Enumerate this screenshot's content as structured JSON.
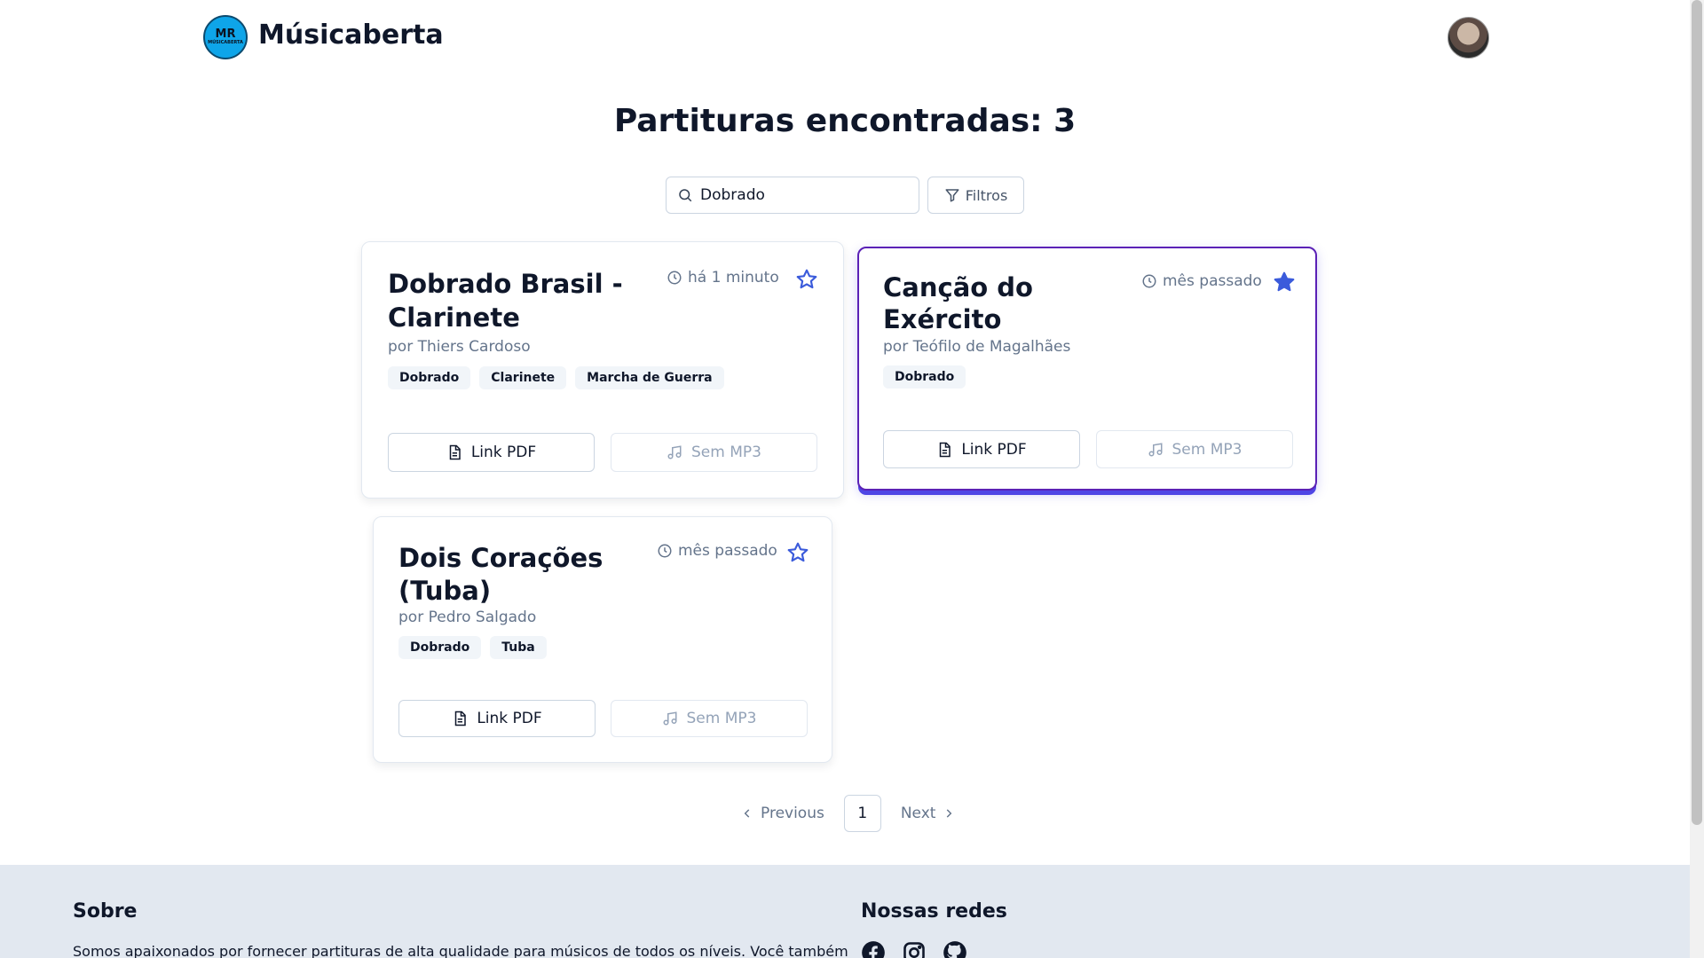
{
  "header": {
    "logo_text": "MR",
    "logo_subtext": "MÚSICABERTA",
    "brand": "Músicaberta"
  },
  "main": {
    "title": "Partituras encontradas: 3",
    "search": {
      "value": "Dobrado",
      "placeholder": ""
    },
    "filter_label": "Filtros"
  },
  "cards": [
    {
      "title_line1": "Dobrado Brasil -",
      "title_line2": "Clarinete",
      "author": "por Thiers Cardoso",
      "time": "há 1 minuto",
      "favorited": false,
      "tags": [
        "Dobrado",
        "Clarinete",
        "Marcha de Guerra"
      ],
      "pdf_label": "Link PDF",
      "mp3_label": "Sem MP3"
    },
    {
      "title_line1": "Canção do",
      "title_line2": "Exército",
      "author": "por Teófilo de Magalhães",
      "time": "mês passado",
      "favorited": true,
      "tags": [
        "Dobrado"
      ],
      "pdf_label": "Link PDF",
      "mp3_label": "Sem MP3"
    },
    {
      "title_line1": "Dois Corações",
      "title_line2": "(Tuba)",
      "author": "por Pedro Salgado",
      "time": "mês passado",
      "favorited": false,
      "tags": [
        "Dobrado",
        "Tuba"
      ],
      "pdf_label": "Link PDF",
      "mp3_label": "Sem MP3"
    }
  ],
  "pagination": {
    "previous": "Previous",
    "current_page": "1",
    "next": "Next"
  },
  "footer": {
    "about_title": "Sobre",
    "about_text": "Somos apaixonados por fornecer partituras de alta qualidade para músicos de todos os níveis. Você também",
    "social_title": "Nossas redes",
    "social_icons": [
      "facebook-icon",
      "instagram-icon",
      "github-icon"
    ]
  },
  "colors": {
    "accent": "#3b5bdb",
    "selected_border": "#5b21b6",
    "footer_bg": "#e2e8f0",
    "muted_text": "#64748b"
  }
}
